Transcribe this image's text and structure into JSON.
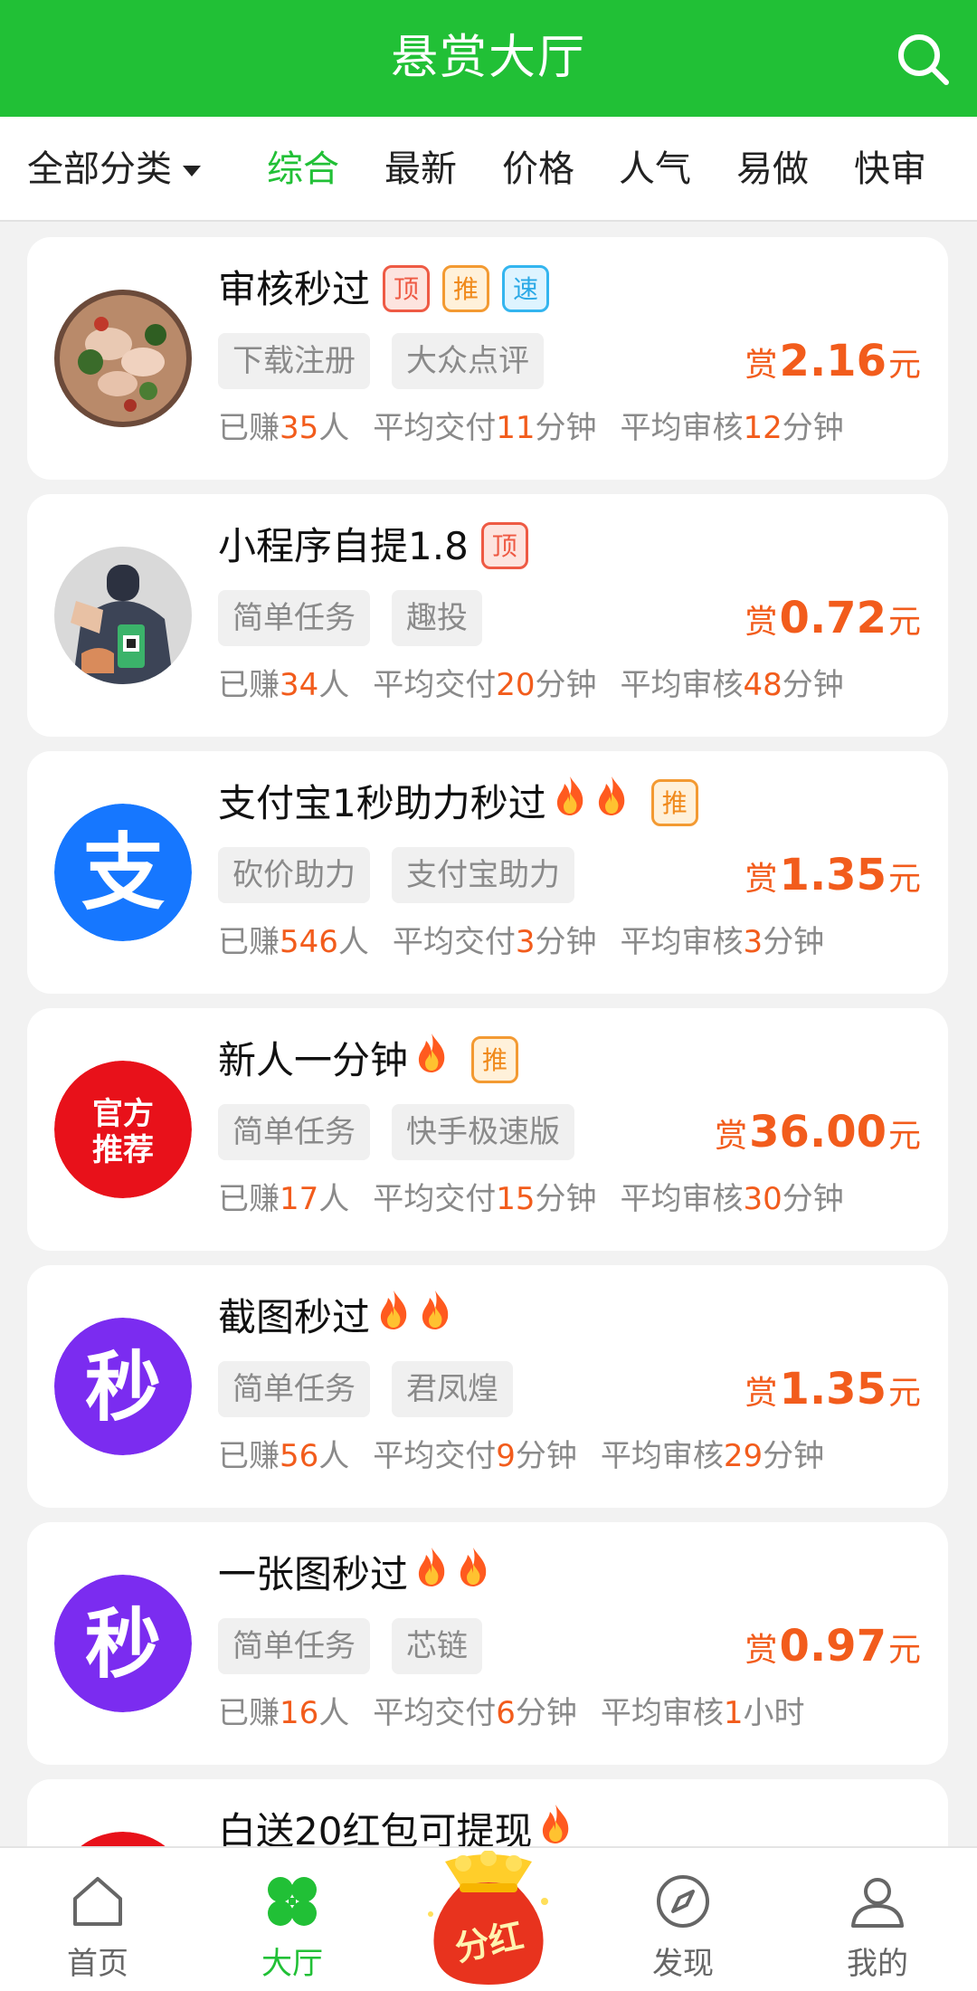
{
  "header": {
    "title": "悬赏大厅",
    "search_icon": "search-icon"
  },
  "filter": {
    "category_label": "全部分类",
    "tabs": [
      {
        "label": "综合",
        "active": true
      },
      {
        "label": "最新",
        "active": false
      },
      {
        "label": "价格",
        "active": false
      },
      {
        "label": "人气",
        "active": false
      },
      {
        "label": "易做",
        "active": false
      },
      {
        "label": "快审",
        "active": false
      }
    ]
  },
  "tasks": [
    {
      "title": "审核秒过",
      "badges": [
        "顶",
        "推",
        "速"
      ],
      "tags": [
        "下载注册",
        "大众点评"
      ],
      "reward_prefix": "赏",
      "reward_amount": "2.16",
      "reward_unit": "元",
      "earned_label": "已赚",
      "earned_count": "35",
      "earned_unit": "人",
      "delivery_label": "平均交付",
      "delivery_value": "11",
      "delivery_unit": "分钟",
      "review_label": "平均审核",
      "review_value": "12",
      "review_unit": "分钟"
    },
    {
      "title": "小程序自提1.8",
      "badges": [
        "顶"
      ],
      "tags": [
        "简单任务",
        "趣投"
      ],
      "reward_prefix": "赏",
      "reward_amount": "0.72",
      "reward_unit": "元",
      "earned_label": "已赚",
      "earned_count": "34",
      "earned_unit": "人",
      "delivery_label": "平均交付",
      "delivery_value": "20",
      "delivery_unit": "分钟",
      "review_label": "平均审核",
      "review_value": "48",
      "review_unit": "分钟"
    },
    {
      "title": "支付宝1秒助力秒过",
      "fires": 2,
      "badges": [
        "推"
      ],
      "tags": [
        "砍价助力",
        "支付宝助力"
      ],
      "reward_prefix": "赏",
      "reward_amount": "1.35",
      "reward_unit": "元",
      "earned_label": "已赚",
      "earned_count": "546",
      "earned_unit": "人",
      "delivery_label": "平均交付",
      "delivery_value": "3",
      "delivery_unit": "分钟",
      "review_label": "平均审核",
      "review_value": "3",
      "review_unit": "分钟",
      "avatar_text": "支"
    },
    {
      "title": "新人一分钟",
      "fires": 1,
      "badges": [
        "推"
      ],
      "tags": [
        "简单任务",
        "快手极速版"
      ],
      "reward_prefix": "赏",
      "reward_amount": "36.00",
      "reward_unit": "元",
      "earned_label": "已赚",
      "earned_count": "17",
      "earned_unit": "人",
      "delivery_label": "平均交付",
      "delivery_value": "15",
      "delivery_unit": "分钟",
      "review_label": "平均审核",
      "review_value": "30",
      "review_unit": "分钟",
      "avatar_text": "官方推荐"
    },
    {
      "title": "截图秒过",
      "fires": 2,
      "badges": [],
      "tags": [
        "简单任务",
        "君凤煌"
      ],
      "reward_prefix": "赏",
      "reward_amount": "1.35",
      "reward_unit": "元",
      "earned_label": "已赚",
      "earned_count": "56",
      "earned_unit": "人",
      "delivery_label": "平均交付",
      "delivery_value": "9",
      "delivery_unit": "分钟",
      "review_label": "平均审核",
      "review_value": "29",
      "review_unit": "分钟",
      "avatar_text": "秒"
    },
    {
      "title": "一张图秒过",
      "fires": 2,
      "badges": [],
      "tags": [
        "简单任务",
        "芯链"
      ],
      "reward_prefix": "赏",
      "reward_amount": "0.97",
      "reward_unit": "元",
      "earned_label": "已赚",
      "earned_count": "16",
      "earned_unit": "人",
      "delivery_label": "平均交付",
      "delivery_value": "6",
      "delivery_unit": "分钟",
      "review_label": "平均审核",
      "review_value": "1",
      "review_unit": "小时",
      "avatar_text": "秒"
    },
    {
      "title": "白送20红包可提现",
      "fires": 1
    }
  ],
  "tabbar": {
    "items": [
      {
        "label": "首页",
        "icon": "home-icon"
      },
      {
        "label": "大厅",
        "icon": "clover-icon",
        "active": true
      },
      {
        "label": "",
        "icon": "red-bag-icon",
        "bag_text": "分红"
      },
      {
        "label": "发现",
        "icon": "compass-icon"
      },
      {
        "label": "我的",
        "icon": "user-icon"
      }
    ]
  },
  "colors": {
    "brand_green": "#21c036",
    "reward_orange": "#f25c1c"
  }
}
